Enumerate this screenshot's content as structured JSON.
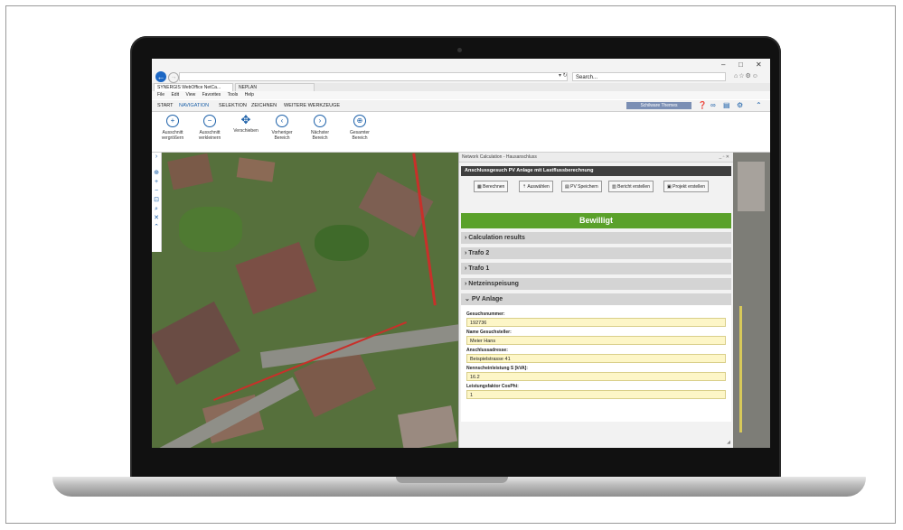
{
  "browser": {
    "url": "",
    "search_placeholder": "Search...",
    "tabs": [
      "SYNERGIS WebOffice NetCa...",
      "NEPLAN"
    ],
    "menu": [
      "File",
      "Edit",
      "View",
      "Favorites",
      "Tools",
      "Help"
    ]
  },
  "ribbon": {
    "tabs": [
      "START",
      "NAVIGATION",
      "SELEKTION",
      "ZEICHNEN",
      "WEITERE WERKZEUGE"
    ],
    "theme_label": "Schilware Themes",
    "buttons": [
      {
        "line1": "Ausschnitt",
        "line2": "vergrößern",
        "icon": "zoom-in-icon"
      },
      {
        "line1": "Ausschnitt",
        "line2": "verkleinern",
        "icon": "zoom-out-icon"
      },
      {
        "line1": "Verschieben",
        "line2": "",
        "icon": "pan-icon"
      },
      {
        "line1": "Vorheriger",
        "line2": "Bereich",
        "icon": "previous-extent-icon"
      },
      {
        "line1": "Nächster",
        "line2": "Bereich",
        "icon": "next-extent-icon"
      },
      {
        "line1": "Gesamter",
        "line2": "Bereich",
        "icon": "full-extent-icon"
      }
    ]
  },
  "panel": {
    "title": "Network Calculation - Hausanschluss",
    "header": "Anschlussgesuch PV Anlage mit Lastflussberechnung",
    "toolbar": [
      "Berechnen",
      "Auswählen",
      "PV Speichern",
      "Bericht erstellen",
      "Projekt erstellen"
    ],
    "status": "Bewilligt",
    "sections": [
      "Calculation results",
      "Trafo 2",
      "Trafo 1",
      "Netzeinspeisung",
      "PV Anlage"
    ],
    "fields": [
      {
        "label": "Gesuchsnummer:",
        "value": "192736"
      },
      {
        "label": "Name Gesuchsteller:",
        "value": "Meier Hans"
      },
      {
        "label": "Anschlussadresse:",
        "value": "Beispielstrasse 41"
      },
      {
        "label": "Nennscheinleistung S [kVA]:",
        "value": "16.2"
      },
      {
        "label": "Leistungsfaktor CosPhi:",
        "value": "1"
      }
    ]
  },
  "colors": {
    "accent": "#1a5fa8",
    "approved": "#5aa12a",
    "field_bg": "#fdf6c7"
  }
}
